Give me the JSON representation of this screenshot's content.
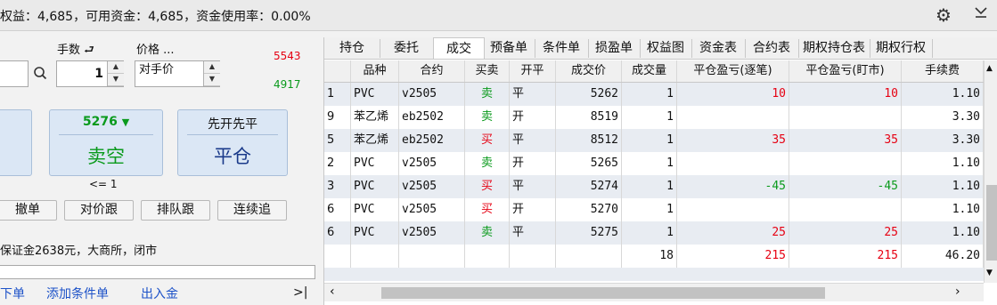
{
  "header": {
    "summary": "权益：4,685，可用资金：4,685，资金使用率：0.00%",
    "icons": [
      "gear-icon",
      "collapse-icon"
    ]
  },
  "order": {
    "qty_label": "手数",
    "qty_value": "1",
    "price_label": "价格 ...",
    "price_value": "对手价",
    "ask_price": "5543",
    "bid_price": "4917"
  },
  "buttons": {
    "sell_price": "5276",
    "sell_arrow": "▼",
    "sell_label": "卖空",
    "close_top": "先开先平",
    "close_label": "平仓",
    "limit_note": "<= 1",
    "cancel": "撤单",
    "chase_counter": "对价跟",
    "chase_queue": "排队跟",
    "chase_continuous": "连续追"
  },
  "margin_text": "保证金2638元，大商所，闭市",
  "links": {
    "place_order": "下单",
    "add_condition": "添加条件单",
    "deposit": "出入金",
    "collapse_sym": ">|"
  },
  "tabs": [
    "持仓",
    "委托",
    "成交",
    "预备单",
    "条件单",
    "损盈单",
    "权益图",
    "资金表",
    "合约表",
    "期权持仓表",
    "期权行权"
  ],
  "active_tab": "成交",
  "table": {
    "headers": [
      "品种",
      "合约",
      "买卖",
      "开平",
      "成交价",
      "成交量",
      "平仓盈亏(逐笔)",
      "平仓盈亏(盯市)",
      "手续费"
    ],
    "rows": [
      {
        "idx": "1",
        "product": "PVC",
        "contract": "v2505",
        "side": "卖",
        "oc": "平",
        "price": "5262",
        "vol": "1",
        "pnl_trade": "10",
        "pnl_mtm": "10",
        "fee": "1.10"
      },
      {
        "idx": "9",
        "product": "苯乙烯",
        "contract": "eb2502",
        "side": "卖",
        "oc": "开",
        "price": "8519",
        "vol": "1",
        "pnl_trade": "",
        "pnl_mtm": "",
        "fee": "3.30"
      },
      {
        "idx": "5",
        "product": "苯乙烯",
        "contract": "eb2502",
        "side": "买",
        "oc": "平",
        "price": "8512",
        "vol": "1",
        "pnl_trade": "35",
        "pnl_mtm": "35",
        "fee": "3.30"
      },
      {
        "idx": "2",
        "product": "PVC",
        "contract": "v2505",
        "side": "卖",
        "oc": "开",
        "price": "5265",
        "vol": "1",
        "pnl_trade": "",
        "pnl_mtm": "",
        "fee": "1.10"
      },
      {
        "idx": "3",
        "product": "PVC",
        "contract": "v2505",
        "side": "买",
        "oc": "平",
        "price": "5274",
        "vol": "1",
        "pnl_trade": "-45",
        "pnl_mtm": "-45",
        "fee": "1.10"
      },
      {
        "idx": "6",
        "product": "PVC",
        "contract": "v2505",
        "side": "买",
        "oc": "开",
        "price": "5270",
        "vol": "1",
        "pnl_trade": "",
        "pnl_mtm": "",
        "fee": "1.10"
      },
      {
        "idx": "6",
        "product": "PVC",
        "contract": "v2505",
        "side": "卖",
        "oc": "平",
        "price": "5275",
        "vol": "1",
        "pnl_trade": "25",
        "pnl_mtm": "25",
        "fee": "1.10"
      }
    ],
    "totals": {
      "vol": "18",
      "pnl_trade": "215",
      "pnl_mtm": "215",
      "fee": "46.20"
    }
  },
  "colors": {
    "buy": "#e60012",
    "sell": "#0a9a1c",
    "accent_blue": "#1d52c8"
  }
}
